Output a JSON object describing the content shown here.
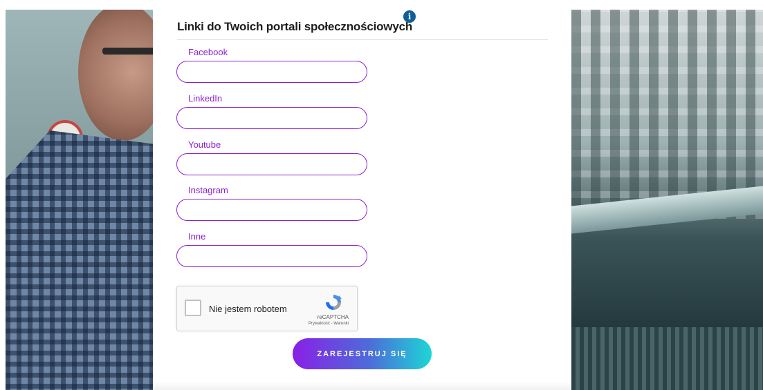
{
  "section": {
    "title": "Linki do Twoich portali społecznościowych",
    "info_icon": "info-icon"
  },
  "fields": [
    {
      "label": "Facebook",
      "value": "",
      "placeholder": ""
    },
    {
      "label": "LinkedIn",
      "value": "",
      "placeholder": ""
    },
    {
      "label": "Youtube",
      "value": "",
      "placeholder": ""
    },
    {
      "label": "Instagram",
      "value": "",
      "placeholder": ""
    },
    {
      "label": "Inne",
      "value": "",
      "placeholder": ""
    }
  ],
  "captcha": {
    "label": "Nie jestem robotem",
    "brand": "reCAPTCHA",
    "links": "Prywatność - Warunki"
  },
  "submit": {
    "label": "ZAREJESTRUJ SIĘ"
  },
  "colors": {
    "accent": "#8a1fd4",
    "info": "#115f9a",
    "button_start": "#8a1fe6",
    "button_end": "#1dd6d6"
  }
}
